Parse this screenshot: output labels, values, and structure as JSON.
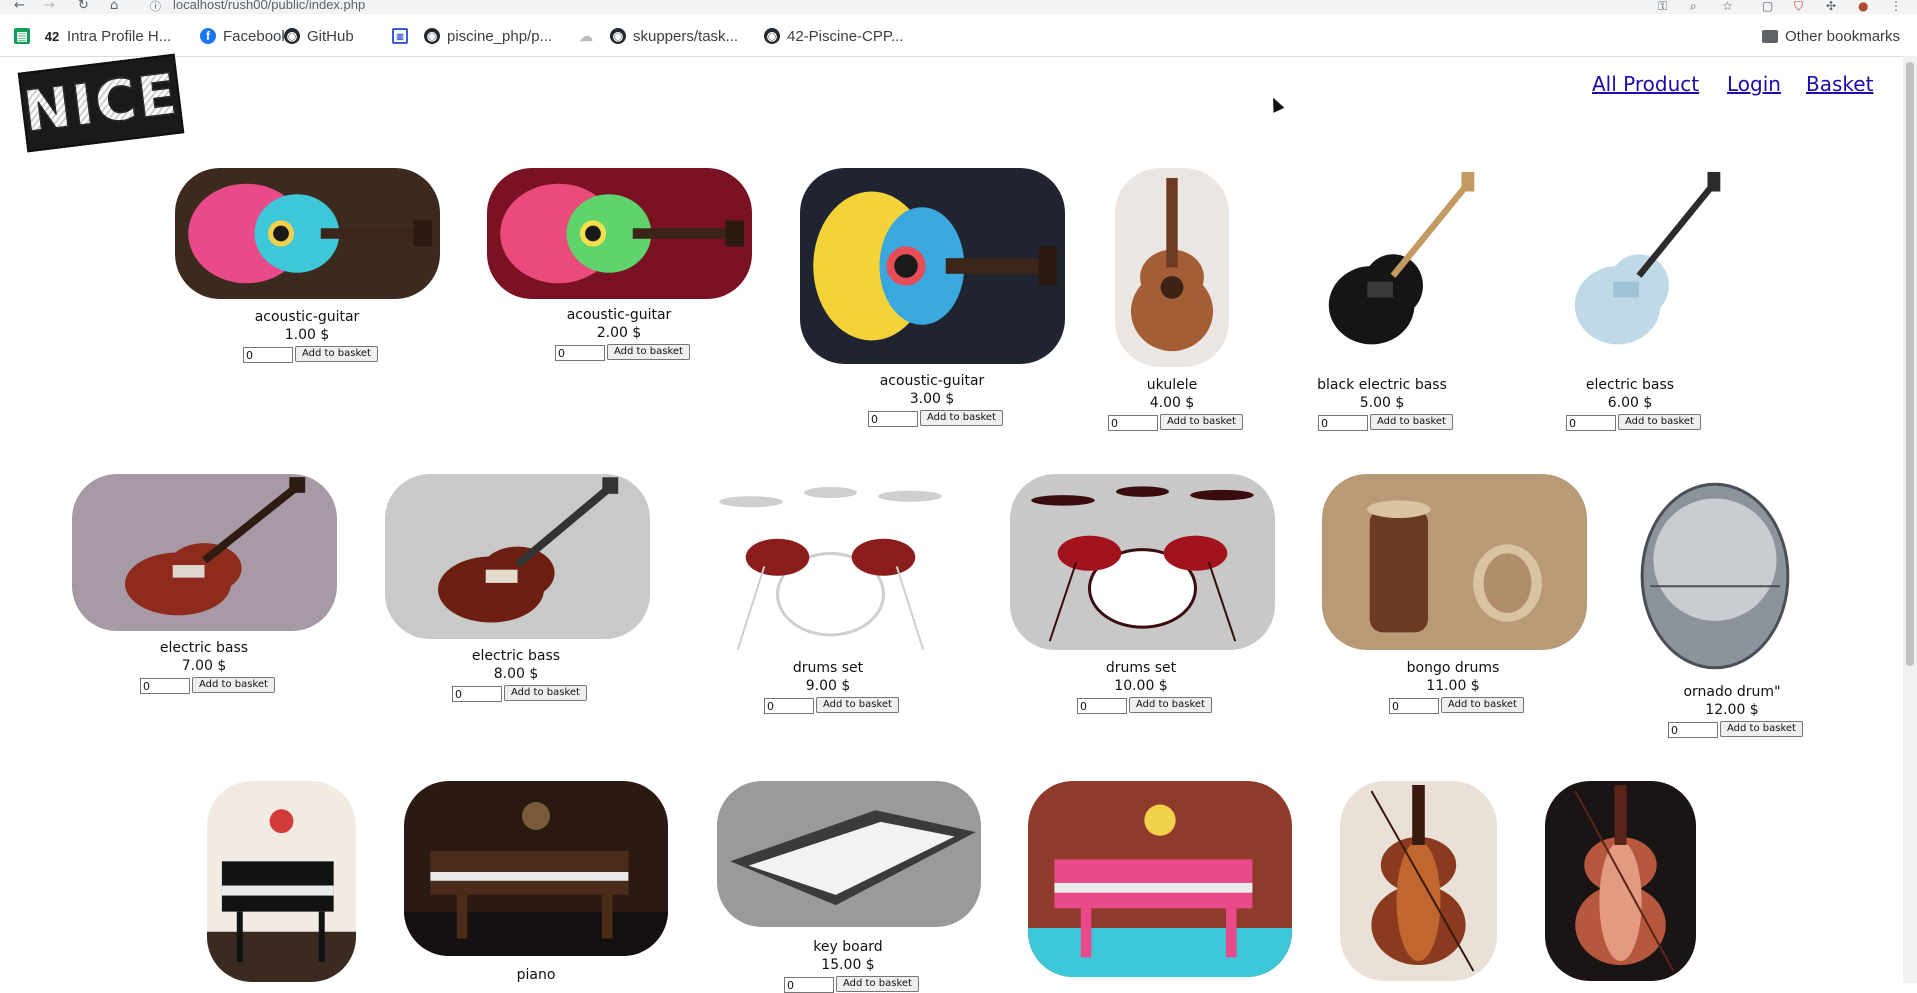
{
  "browser": {
    "url": "localhost/rush00/public/index.php",
    "bookmarks": [
      {
        "label": "",
        "icon": "sheets-icon"
      },
      {
        "label": "Intra Profile H...",
        "icon": "42-icon"
      },
      {
        "label": "Facebook",
        "icon": "facebook-icon"
      },
      {
        "label": "GitHub",
        "icon": "github-icon"
      },
      {
        "label": "",
        "icon": "grid-icon"
      },
      {
        "label": "piscine_php/p...",
        "icon": "github-icon"
      },
      {
        "label": "",
        "icon": "cloud-icon"
      },
      {
        "label": "skuppers/task...",
        "icon": "github-icon"
      },
      {
        "label": "42-Piscine-CPP...",
        "icon": "github-icon"
      }
    ],
    "other_bookmarks": "Other bookmarks"
  },
  "site": {
    "logo_text": "NICE",
    "nav": {
      "all_product": "All Product",
      "login": "Login",
      "basket": "Basket"
    },
    "add_label": "Add to basket",
    "qty_default": "0"
  },
  "products": [
    {
      "name": "acoustic-guitar",
      "price": "1.00 $",
      "image": "acoustic-guitar-icon",
      "colors": [
        "#3b2a1d",
        "#e84a8a",
        "#3ec7d8",
        "#f2d14a"
      ]
    },
    {
      "name": "acoustic-guitar",
      "price": "2.00 $",
      "image": "acoustic-guitar-icon",
      "colors": [
        "#7a1224",
        "#e94b7a",
        "#5fd36c",
        "#f4e04d"
      ]
    },
    {
      "name": "acoustic-guitar",
      "price": "3.00 $",
      "image": "acoustic-guitar-icon",
      "colors": [
        "#1f2430",
        "#f3d23a",
        "#3aa7de",
        "#e84c56"
      ]
    },
    {
      "name": "ukulele",
      "price": "4.00 $",
      "image": "ukulele-icon",
      "colors": [
        "#ebe6e2",
        "#6b3b22",
        "#a45e36",
        "#3d2316"
      ]
    },
    {
      "name": "black electric bass",
      "price": "5.00 $",
      "image": "electric-bass-icon",
      "colors": [
        "#ffffff",
        "#151515",
        "#3a3a3a",
        "#c49a63"
      ]
    },
    {
      "name": "electric bass",
      "price": "6.00 $",
      "image": "electric-bass-icon",
      "colors": [
        "#ffffff",
        "#bfd9e6",
        "#9ec3d6",
        "#2b2b2b"
      ]
    },
    {
      "name": "electric bass",
      "price": "7.00 $",
      "image": "electric-bass-icon",
      "colors": [
        "#a79aa6",
        "#8e2b1c",
        "#e0d7d0",
        "#2e1b12"
      ]
    },
    {
      "name": "electric bass",
      "price": "8.00 $",
      "image": "electric-bass-icon",
      "colors": [
        "#c9c9c9",
        "#6d1f12",
        "#e3dccc",
        "#333333"
      ]
    },
    {
      "name": "drums set",
      "price": "9.00 $",
      "image": "drums-icon",
      "colors": [
        "#ffffff",
        "#8c1d1d",
        "#222222",
        "#cfcfcf"
      ]
    },
    {
      "name": "drums set",
      "price": "10.00 $",
      "image": "drums-icon",
      "colors": [
        "#c8c8c8",
        "#a3131e",
        "#e21f36",
        "#3a0c10"
      ]
    },
    {
      "name": "bongo drums",
      "price": "11.00 $",
      "image": "bongo-drums-icon",
      "colors": [
        "#b89a77",
        "#6b3a22",
        "#d9c3a1",
        "#8a5a36"
      ]
    },
    {
      "name": "ornado drum\"",
      "price": "12.00 $",
      "image": "snare-drum-icon",
      "colors": [
        "#ffffff",
        "#c9ccd1",
        "#8d939b",
        "#4b5058"
      ]
    },
    {
      "name": "",
      "price": "",
      "image": "grand-piano-icon",
      "colors": [
        "#f1ebe4",
        "#121212",
        "#3a2a20",
        "#d33a3a"
      ]
    },
    {
      "name": "piano",
      "price": "",
      "image": "grand-piano-icon",
      "colors": [
        "#2a1a12",
        "#4b2c1a",
        "#151010",
        "#7a5a3a"
      ]
    },
    {
      "name": "key board",
      "price": "15.00 $",
      "image": "keyboard-icon",
      "colors": [
        "#9a9a9a",
        "#3b3b3b",
        "#f2f2f2",
        "#5e5e5e"
      ]
    },
    {
      "name": "",
      "price": "",
      "image": "grand-piano-icon",
      "colors": [
        "#8e3b2c",
        "#e84a8a",
        "#3ec7d8",
        "#f2d14a"
      ]
    },
    {
      "name": "",
      "price": "",
      "image": "violin-icon",
      "colors": [
        "#e9e1d8",
        "#8a3a1e",
        "#c0662f",
        "#3a1a0e"
      ]
    },
    {
      "name": "",
      "price": "",
      "image": "violin-icon",
      "colors": [
        "#1a1414",
        "#b5583d",
        "#e39a80",
        "#5a2418"
      ]
    }
  ]
}
